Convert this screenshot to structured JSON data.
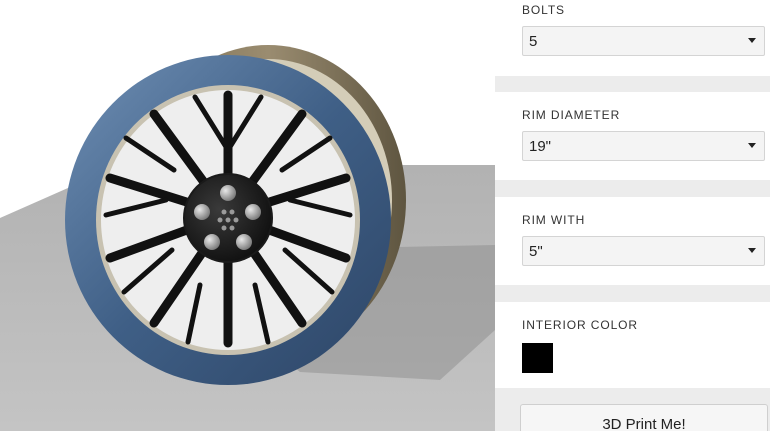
{
  "config": {
    "bolts": {
      "label": "BOLTS",
      "value": "5"
    },
    "rim_diameter": {
      "label": "RIM DIAMETER",
      "value": "19\""
    },
    "rim_width": {
      "label": "RIM WITH",
      "value": "5\""
    },
    "interior_color": {
      "label": "INTERIOR COLOR",
      "color": "#000000"
    }
  },
  "actions": {
    "print_label": "3D Print Me!"
  },
  "viewport": {
    "object": "wheel-rim-3d-model",
    "spoke_count": 10,
    "bolt_count": 5,
    "rim_color": "#4a6a8e",
    "spoke_color": "#111111",
    "floor_color": "#b8b8b8"
  }
}
